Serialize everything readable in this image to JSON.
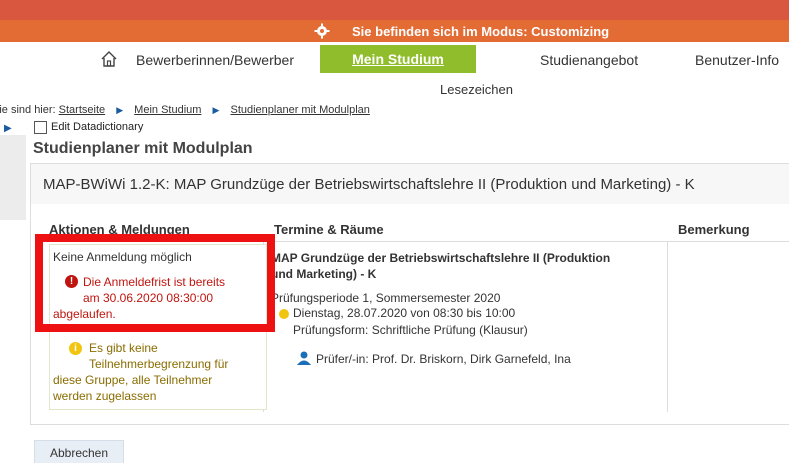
{
  "mode_bar": {
    "text": "Sie befinden sich im Modus: Customizing",
    "icon": "gear-icon",
    "color": "#e36b34"
  },
  "nav": {
    "home_icon": "home-icon",
    "items": [
      "Bewerberinnen/Bewerber",
      "Mein Studium",
      "Studienangebot",
      "Benutzer-Info"
    ],
    "active_index": 1,
    "active_color": "#8fbd2b"
  },
  "bookmarks_label": "Lesezeichen",
  "breadcrumb": {
    "prefix": "Sie sind hier:",
    "items": [
      "Startseite",
      "Mein Studium",
      "Studienplaner mit Modulplan"
    ]
  },
  "edit_datadictionary_label": "Edit Datadictionary",
  "page_title": "Studienplaner mit Modulplan",
  "module": {
    "title": "MAP-BWiWi 1.2-K: MAP Grundzüge der Betriebswirtschaftslehre II (Produktion und Marketing) - K",
    "columns": [
      "Aktionen & Meldungen",
      "Termine & Räume",
      "Bemerkung"
    ],
    "action": {
      "status": "Keine Anmeldung möglich",
      "error": {
        "line1": "Die Anmeldefrist ist bereits",
        "line2": "am 30.06.2020 08:30:00",
        "line3": "abgelaufen.",
        "color": "#c0150f"
      },
      "info": {
        "line1": "Es gibt keine",
        "line2": "Teilnehmerbegrenzung für",
        "line3": "diese Gruppe, alle Teilnehmer",
        "line4": "werden zugelassen"
      }
    },
    "termin": {
      "title_line1": "MAP Grundzüge der Betriebswirtschaftslehre II (Produktion",
      "title_line2": "und Marketing) - K",
      "period": "Prüfungsperiode 1, Sommersemester 2020",
      "date": "Dienstag, 28.07.2020 von 08:30 bis 10:00",
      "form": "Prüfungsform: Schriftliche Prüfung (Klausur)",
      "examiners": "Prüfer/-in: Prof. Dr. Briskorn, Dirk Garnefeld, Ina"
    }
  },
  "cancel_button": "Abbrechen"
}
